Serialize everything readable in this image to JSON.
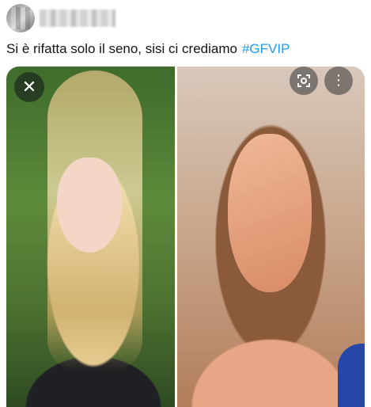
{
  "tweet": {
    "text": "Si è rifatta solo il seno, sisi ci crediamo",
    "hashtag": "#GFVIP",
    "more_icon": "more-horizontal-icon"
  },
  "media": {
    "left_photo_icon": "close-icon",
    "right_photo_icons": [
      "scan-icon",
      "more-vertical-icon"
    ]
  },
  "colors": {
    "hashtag": "#1d9bf0",
    "text": "#0f1419",
    "overlay": "#0f1419"
  }
}
